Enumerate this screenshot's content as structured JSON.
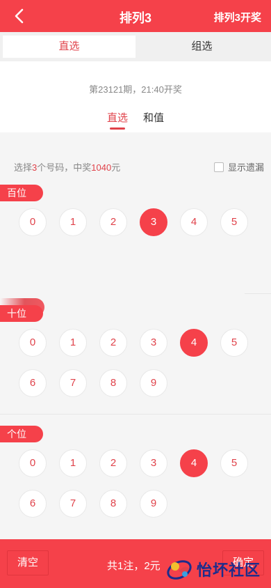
{
  "header": {
    "title": "排列3",
    "right_label": "排列3开奖"
  },
  "tabs": [
    {
      "label": "直选"
    },
    {
      "label": "组选"
    }
  ],
  "info": {
    "issue_text": "第23121期，21:40开奖"
  },
  "subtabs": [
    {
      "label": "直选"
    },
    {
      "label": "和值"
    }
  ],
  "hint": {
    "prefix": "选择",
    "count": "3",
    "mid": "个号码，中奖",
    "prize": "1040",
    "suffix": "元"
  },
  "omit_label": "显示遗漏",
  "groups": [
    {
      "label": "百位",
      "balls": [
        "0",
        "1",
        "2",
        "3",
        "4",
        "5"
      ],
      "selected": "3"
    },
    {
      "label": "十位",
      "balls": [
        "0",
        "1",
        "2",
        "3",
        "4",
        "5",
        "6",
        "7",
        "8",
        "9"
      ],
      "selected": "4"
    },
    {
      "label": "个位",
      "balls": [
        "0",
        "1",
        "2",
        "3",
        "4",
        "5",
        "6",
        "7",
        "8",
        "9"
      ],
      "selected": "4"
    }
  ],
  "footer": {
    "clear_label": "清空",
    "total_text": "共1注，2元",
    "confirm_label": "确定"
  },
  "watermark": {
    "text": "怡坏社区"
  },
  "colors": {
    "accent": "#f5414a"
  }
}
